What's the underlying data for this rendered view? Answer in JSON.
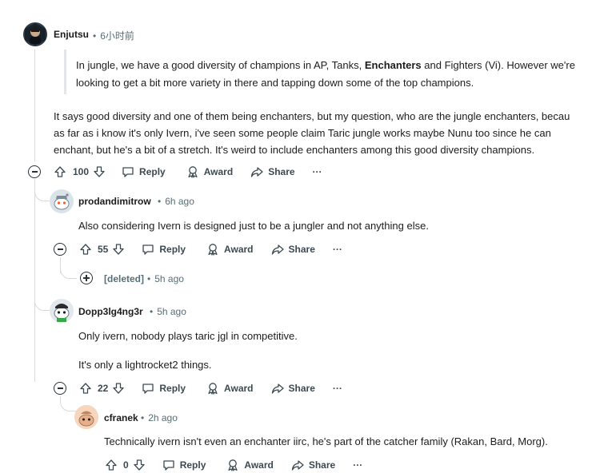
{
  "post": {
    "author": "Enjutsu",
    "time": "6小时前",
    "quote_line1_pre": "In jungle, we have a good diversity of champions in AP, Tanks, ",
    "quote_line1_bold": "Enchanters",
    "quote_line1_post": " and Fighters (Vi). However we're",
    "quote_line2": "looking to get a bit more variety in there and tapping down some of the top champions.",
    "body_line1": "It says good diversity and one of them being enchanters, but my question, who are the jungle enchanters, becau",
    "body_line2": "as far as i know it's only Ivern, i've seen some people claim Taric jungle works maybe Nunu too since he can",
    "body_line3": "enchant, but he's a bit of a stretch. It's weird to include enchanters among this good diversity champions.",
    "votes": "100"
  },
  "labels": {
    "reply": "Reply",
    "award": "Award",
    "share": "Share",
    "more": "···"
  },
  "replies": [
    {
      "author": "prodandimitrow",
      "time": "6h ago",
      "body": "Also considering Ivern is designed just to be a jungler and not anything else.",
      "votes": "55"
    },
    {
      "author": "Dopp3lg4ng3r",
      "time": "5h ago",
      "body_line1": "Only ivern, nobody plays taric jgl in competitive.",
      "body_line2": "It's only a lightrocket2 things.",
      "votes": "22"
    },
    {
      "author": "cfranek",
      "time": "2h ago",
      "body": "Technically ivern isn't even an enchanter iirc, he's part of the catcher family (Rakan, Bard, Morg).",
      "votes": "0"
    }
  ],
  "deleted": {
    "label": "[deleted]",
    "time": "5h ago"
  },
  "colors": {
    "text": "#1c1c1c",
    "meta": "#576f76",
    "thread": "#d7dadc",
    "action": "#3c4a50"
  }
}
